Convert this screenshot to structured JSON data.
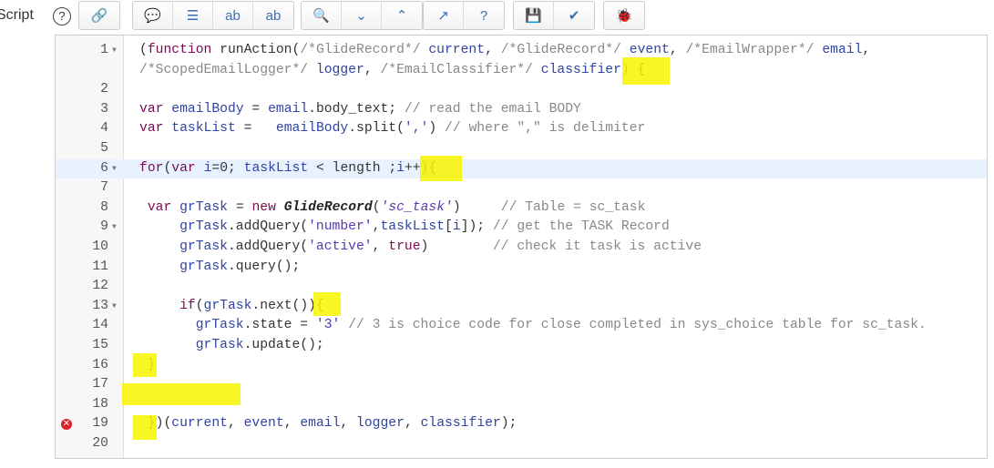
{
  "field_label": "Script",
  "help_icon": "?",
  "toolbar": [
    {
      "group": [
        {
          "icon": "script-debug-icon",
          "glyph": "🔗"
        }
      ]
    },
    {
      "group": [
        {
          "icon": "comment-icon",
          "glyph": "💬"
        },
        {
          "icon": "format-icon",
          "glyph": "☰"
        },
        {
          "icon": "replace-icon",
          "glyph": "ab"
        },
        {
          "icon": "replace-all-icon",
          "glyph": "ab"
        }
      ]
    },
    {
      "group": [
        {
          "icon": "search-icon",
          "glyph": "🔍"
        },
        {
          "icon": "next-icon",
          "glyph": "⌄"
        },
        {
          "icon": "previous-icon",
          "glyph": "⌃"
        }
      ]
    },
    {
      "group": [
        {
          "icon": "fullscreen-icon",
          "glyph": "↗"
        },
        {
          "icon": "help-icon",
          "glyph": "?"
        }
      ]
    },
    {
      "group": [
        {
          "icon": "save-icon",
          "glyph": "💾"
        },
        {
          "icon": "check-syntax-icon",
          "glyph": "✔"
        }
      ]
    },
    {
      "group": [
        {
          "icon": "debug-icon",
          "glyph": "🐞"
        }
      ]
    }
  ],
  "lines": [
    {
      "n": "1",
      "fold": true,
      "segs": [
        [
          "(",
          "p"
        ],
        [
          "function",
          "k"
        ],
        [
          " runAction(",
          "p"
        ],
        [
          "/*GlideRecord*/",
          "c"
        ],
        [
          " ",
          "p"
        ],
        [
          "current",
          "v"
        ],
        [
          ", ",
          "p"
        ],
        [
          "/*GlideRecord*/",
          "c"
        ],
        [
          " ",
          "p"
        ],
        [
          "event",
          "v"
        ],
        [
          ", ",
          "p"
        ],
        [
          "/*EmailWrapper*/",
          "c"
        ],
        [
          " ",
          "p"
        ],
        [
          "email",
          "v"
        ],
        [
          ",",
          "p"
        ]
      ]
    },
    {
      "n": "",
      "segs": [
        [
          "/*ScopedEmailLogger*/",
          "c"
        ],
        [
          " ",
          "p"
        ],
        [
          "logger",
          "v"
        ],
        [
          ", ",
          "p"
        ],
        [
          "/*EmailClassifier*/",
          "c"
        ],
        [
          " ",
          "p"
        ],
        [
          "classifier",
          "v"
        ],
        [
          ") {",
          "p"
        ]
      ]
    },
    {
      "n": "2",
      "segs": []
    },
    {
      "n": "3",
      "segs": [
        [
          "var",
          "k"
        ],
        [
          " ",
          "p"
        ],
        [
          "emailBody",
          "v"
        ],
        [
          " = ",
          "p"
        ],
        [
          "email",
          "v"
        ],
        [
          ".body_text; ",
          "p"
        ],
        [
          "// read the email BODY",
          "c"
        ]
      ]
    },
    {
      "n": "4",
      "segs": [
        [
          "var",
          "k"
        ],
        [
          " ",
          "p"
        ],
        [
          "taskList",
          "v"
        ],
        [
          " =   ",
          "p"
        ],
        [
          "emailBody",
          "v"
        ],
        [
          ".split(",
          "p"
        ],
        [
          "','",
          "s"
        ],
        [
          ") ",
          "p"
        ],
        [
          "// where \",\" is delimiter",
          "c"
        ]
      ]
    },
    {
      "n": "5",
      "segs": []
    },
    {
      "n": "6",
      "fold": true,
      "active": true,
      "segs": [
        [
          "for",
          "k"
        ],
        [
          "(",
          "p"
        ],
        [
          "var",
          "k"
        ],
        [
          " ",
          "p"
        ],
        [
          "i",
          "v"
        ],
        [
          "=0; ",
          "p"
        ],
        [
          "taskList",
          "v"
        ],
        [
          " < ",
          "p"
        ],
        [
          "length",
          "p"
        ],
        [
          " ;",
          "p"
        ],
        [
          "i",
          "v"
        ],
        [
          "++){",
          "p"
        ]
      ]
    },
    {
      "n": "7",
      "segs": []
    },
    {
      "n": "8",
      "segs": [
        [
          " ",
          "p"
        ],
        [
          "var",
          "k"
        ],
        [
          " ",
          "p"
        ],
        [
          "grTask",
          "v"
        ],
        [
          " = ",
          "p"
        ],
        [
          "new",
          "k"
        ],
        [
          " ",
          "p"
        ],
        [
          "GlideRecord",
          "t"
        ],
        [
          "(",
          "p"
        ],
        [
          "'sc_task'",
          "si"
        ],
        [
          ")     ",
          "p"
        ],
        [
          "// Table = sc_task",
          "c"
        ]
      ]
    },
    {
      "n": "9",
      "fold": true,
      "segs": [
        [
          "     ",
          "p"
        ],
        [
          "grTask",
          "v"
        ],
        [
          ".addQuery(",
          "p"
        ],
        [
          "'number'",
          "s"
        ],
        [
          ",",
          "p"
        ],
        [
          "taskList",
          "v"
        ],
        [
          "[",
          "p"
        ],
        [
          "i",
          "v"
        ],
        [
          "]); ",
          "p"
        ],
        [
          "// get the TASK Record",
          "c"
        ]
      ]
    },
    {
      "n": "10",
      "segs": [
        [
          "     ",
          "p"
        ],
        [
          "grTask",
          "v"
        ],
        [
          ".addQuery(",
          "p"
        ],
        [
          "'active'",
          "s"
        ],
        [
          ", ",
          "p"
        ],
        [
          "true",
          "k"
        ],
        [
          ")        ",
          "p"
        ],
        [
          "// check it task is active",
          "c"
        ]
      ]
    },
    {
      "n": "11",
      "segs": [
        [
          "     ",
          "p"
        ],
        [
          "grTask",
          "v"
        ],
        [
          ".query();",
          "p"
        ]
      ]
    },
    {
      "n": "12",
      "segs": []
    },
    {
      "n": "13",
      "fold": true,
      "segs": [
        [
          "     ",
          "p"
        ],
        [
          "if",
          "k"
        ],
        [
          "(",
          "p"
        ],
        [
          "grTask",
          "v"
        ],
        [
          ".next()){",
          "p"
        ]
      ]
    },
    {
      "n": "14",
      "segs": [
        [
          "       ",
          "p"
        ],
        [
          "grTask",
          "v"
        ],
        [
          ".state = ",
          "p"
        ],
        [
          "'3'",
          "s"
        ],
        [
          " ",
          "p"
        ],
        [
          "// 3 is choice code for close completed in sys_choice table for sc_task.",
          "c"
        ]
      ]
    },
    {
      "n": "15",
      "segs": [
        [
          "       ",
          "p"
        ],
        [
          "grTask",
          "v"
        ],
        [
          ".update();",
          "p"
        ]
      ]
    },
    {
      "n": "16",
      "segs": [
        [
          " }",
          "p"
        ]
      ]
    },
    {
      "n": "17",
      "segs": []
    },
    {
      "n": "18",
      "segs": []
    },
    {
      "n": "19",
      "error": true,
      "segs": [
        [
          " })(",
          "p"
        ],
        [
          "current",
          "v"
        ],
        [
          ", ",
          "p"
        ],
        [
          "event",
          "v"
        ],
        [
          ", ",
          "p"
        ],
        [
          "email",
          "v"
        ],
        [
          ", ",
          "p"
        ],
        [
          "logger",
          "v"
        ],
        [
          ", ",
          "p"
        ],
        [
          "classifier",
          "v"
        ],
        [
          ");",
          "p"
        ]
      ]
    },
    {
      "n": "20",
      "segs": []
    }
  ],
  "colors": {
    "highlight": "#f8f500",
    "active_line": "#e8f2ff",
    "error": "#d9222a"
  }
}
